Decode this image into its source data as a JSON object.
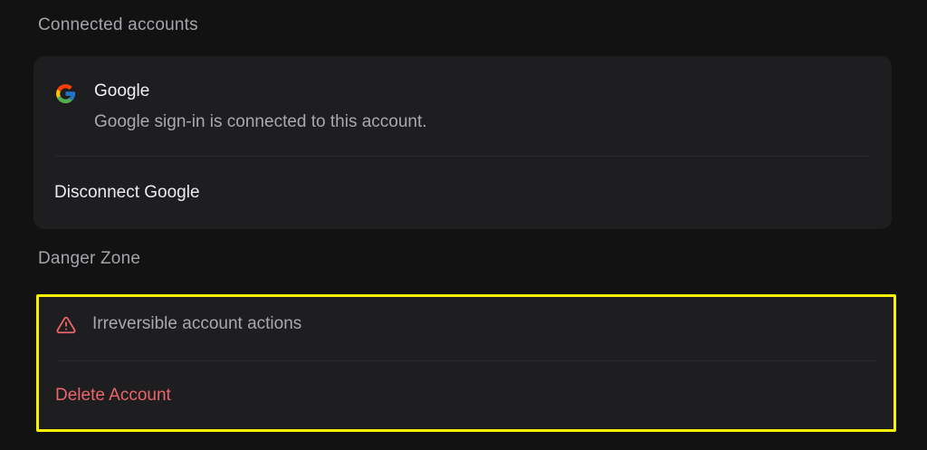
{
  "connected_accounts": {
    "title": "Connected accounts",
    "google": {
      "name": "Google",
      "description": "Google sign-in is connected to this account.",
      "icon": "google-icon",
      "disconnect_label": "Disconnect Google"
    }
  },
  "danger_zone": {
    "title": "Danger Zone",
    "description": "Irreversible account actions",
    "icon": "warning-icon",
    "delete_label": "Delete Account",
    "colors": {
      "danger": "#e8656b",
      "highlight_border": "#f6f200"
    }
  }
}
